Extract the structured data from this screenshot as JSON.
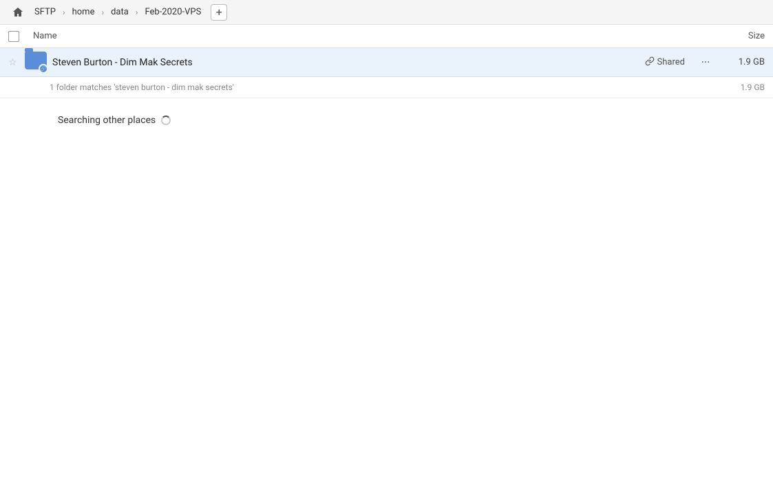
{
  "breadcrumb": {
    "items": [
      {
        "label": "SFTP",
        "id": "sftp"
      },
      {
        "label": "home",
        "id": "home"
      },
      {
        "label": "data",
        "id": "data"
      },
      {
        "label": "Feb-2020-VPS",
        "id": "feb2020vps"
      }
    ],
    "add_label": "+"
  },
  "columns": {
    "name_label": "Name",
    "size_label": "Size"
  },
  "file_row": {
    "name": "Steven Burton - Dim Mak Secrets",
    "shared_label": "Shared",
    "size": "1.9 GB",
    "more_dots": "···"
  },
  "match_info": {
    "text": "1 folder matches 'steven burton - dim mak secrets'",
    "size": "1.9 GB"
  },
  "searching": {
    "label": "Searching other places"
  }
}
